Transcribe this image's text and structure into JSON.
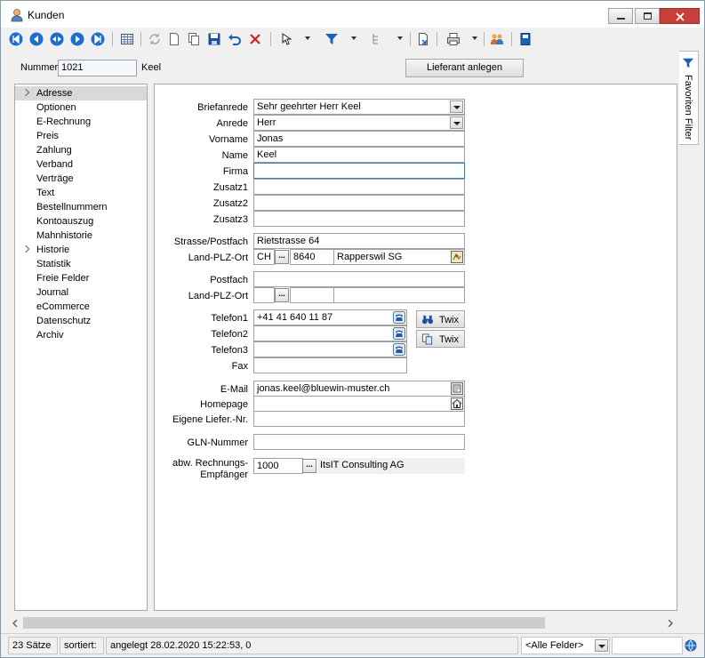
{
  "window": {
    "title": "Kunden"
  },
  "header": {
    "nummer_label": "Nummer",
    "nummer_value": "1021",
    "name_value": "Keel",
    "lieferant_button": "Lieferant anlegen"
  },
  "side_tab": {
    "label": "Favoriten Filter"
  },
  "nav": {
    "items": [
      {
        "label": "Adresse",
        "expandable": true,
        "selected": true
      },
      {
        "label": "Optionen"
      },
      {
        "label": "E-Rechnung"
      },
      {
        "label": "Preis"
      },
      {
        "label": "Zahlung"
      },
      {
        "label": "Verband"
      },
      {
        "label": "Verträge"
      },
      {
        "label": "Text"
      },
      {
        "label": "Bestellnummern"
      },
      {
        "label": "Kontoauszug"
      },
      {
        "label": "Mahnhistorie"
      },
      {
        "label": "Historie",
        "expandable": true
      },
      {
        "label": "Statistik"
      },
      {
        "label": "Freie Felder"
      },
      {
        "label": "Journal"
      },
      {
        "label": "eCommerce"
      },
      {
        "label": "Datenschutz"
      },
      {
        "label": "Archiv"
      }
    ]
  },
  "form": {
    "briefanrede": {
      "label": "Briefanrede",
      "value": "Sehr geehrter Herr Keel"
    },
    "anrede": {
      "label": "Anrede",
      "value": "Herr"
    },
    "vorname": {
      "label": "Vorname",
      "value": "Jonas"
    },
    "name": {
      "label": "Name",
      "value": "Keel"
    },
    "firma": {
      "label": "Firma",
      "value": ""
    },
    "zusatz1": {
      "label": "Zusatz1",
      "value": ""
    },
    "zusatz2": {
      "label": "Zusatz2",
      "value": ""
    },
    "zusatz3": {
      "label": "Zusatz3",
      "value": ""
    },
    "strasse": {
      "label": "Strasse/Postfach",
      "value": "Rietstrasse 64"
    },
    "land_plz_ort": {
      "label": "Land-PLZ-Ort",
      "land": "CH",
      "plz": "8640",
      "ort": "Rapperswil SG"
    },
    "postfach": {
      "label": "Postfach",
      "value": ""
    },
    "land_plz_ort2": {
      "label": "Land-PLZ-Ort",
      "land": "",
      "plz": "",
      "ort": ""
    },
    "telefon1": {
      "label": "Telefon1",
      "value": "+41 41 640 11 87"
    },
    "telefon2": {
      "label": "Telefon2",
      "value": ""
    },
    "telefon3": {
      "label": "Telefon3",
      "value": ""
    },
    "fax": {
      "label": "Fax",
      "value": ""
    },
    "twix1": "Twix",
    "twix2": "Twix",
    "email": {
      "label": "E-Mail",
      "value": "jonas.keel@bluewin-muster.ch"
    },
    "homepage": {
      "label": "Homepage",
      "value": ""
    },
    "eigene_lief": {
      "label": "Eigene Liefer.-Nr.",
      "value": ""
    },
    "gln": {
      "label": "GLN-Nummer",
      "value": ""
    },
    "abw_label_1": "abw. Rechnungs-",
    "abw_label_2": "Empfänger",
    "abw_nummer": "1000",
    "abw_name": "ItsIT Consulting AG"
  },
  "status": {
    "count": "23 Sätze",
    "sorted": "sortiert:",
    "created": "angelegt 28.02.2020 15:22:53,  0",
    "filter": "<Alle Felder>"
  }
}
